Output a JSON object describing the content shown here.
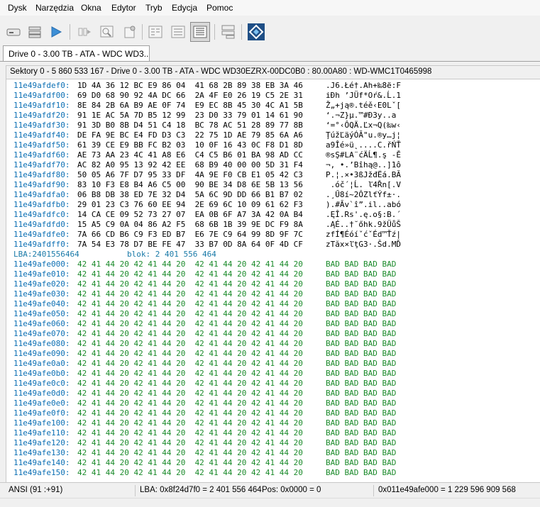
{
  "menu": [
    "Dysk",
    "Narzędzia",
    "Okna",
    "Edytor",
    "Tryb",
    "Edycja",
    "Pomoc"
  ],
  "toolbar": {
    "icons": [
      "drive-icon",
      "list-icon",
      "play-icon",
      "jump-icon",
      "search-icon",
      "settings-icon",
      "view-text-icon",
      "view-columns-icon",
      "view-hex-icon",
      "split-icon",
      "app-logo-icon"
    ]
  },
  "tab": {
    "label": "Drive 0 - 3.00 TB - ATA - WDC WD3..."
  },
  "info": {
    "text": "Sektory 0 - 5 860 533 167 - Drive 0 - 3.00 TB - ATA - WDC WD30EZRX-00DC0B0 : 80.00A80 : WD-WMC1T0465998"
  },
  "data_rows": [
    {
      "addr": "11e49afdef0:",
      "hex": "1D 4A 36 12 BC E9 86 04  41 68 2B 89 38 EB 3A 46",
      "ascii": ".J6.Łé†.Ah+‰8ë:F"
    },
    {
      "addr": "11e49afdf00:",
      "hex": "69 D0 68 90 92 4A DC 66  2A 4F E0 26 19 C5 2E 31",
      "ascii": "iĐh ’JÜf*Oŕ&.Ĺ.1"
    },
    {
      "addr": "11e49afdf10:",
      "hex": "8E 84 2B 6A B9 AE 0F 74  E9 EC 8B 45 30 4C A1 5B",
      "ascii": "Ž„+ją®.téě‹E0Lˇ["
    },
    {
      "addr": "11e49afdf20:",
      "hex": "91 1E AC 5A 7D B5 12 99  23 D0 33 79 01 14 61 90",
      "ascii": "‘.¬Z}µ.™#Đ3y..a "
    },
    {
      "addr": "11e49afdf30:",
      "hex": "91 3D B0 8B D4 51 C4 18  BC 78 AC 51 28 89 77 8B",
      "ascii": "‘=°‹ÔQÄ.Ľx¬Q(‰w‹"
    },
    {
      "addr": "11e49afdf40:",
      "hex": "DE FA 9E BC E4 FD D3 C3  22 75 1D AE 79 85 6A A6",
      "ascii": "ŢúžĽäýÓĂ\"u.®y…j¦"
    },
    {
      "addr": "11e49afdf50:",
      "hex": "61 39 CE E9 BB FC B2 03  10 0F 16 43 0C F8 D1 8D",
      "ascii": "a9Îé»ü˛....C.řŃŤ"
    },
    {
      "addr": "11e49afdf60:",
      "hex": "AE 73 AA 23 4C 41 A8 E6  C4 C5 B6 01 BA 98 AD CC",
      "ascii": "®sŞ#LA¨ćÄĹ¶.ş -Ě"
    },
    {
      "addr": "11e49afdf70:",
      "hex": "AC 82 A0 95 13 92 42 EE  68 B9 40 00 00 5D 31 F4",
      "ascii": "¬‚ •.’Bîhą@..]1ô"
    },
    {
      "addr": "11e49afdf80:",
      "hex": "50 05 A6 7F D7 95 33 DF  4A 9E F0 CB E1 05 42 C3",
      "ascii": "P.¦.×•3ßJžđËá.BĂ"
    },
    {
      "addr": "11e49afdf90:",
      "hex": "83 10 F3 E8 B4 A6 C5 00  90 BE 34 D8 6E 5B 13 56",
      "ascii": " .óč´¦Ĺ. ľ4Řn[.V"
    },
    {
      "addr": "11e49afdfa0:",
      "hex": "06 B8 DB 38 ED 7E 32 D4  5A 6C 9D DD 66 B1 B7 02",
      "ascii": ".¸Ű8í~2ÔZlťÝf±·."
    },
    {
      "addr": "11e49afdfb0:",
      "hex": "29 01 23 C3 76 60 EE 94  2E 69 6C 10 09 61 62 F3",
      "ascii": ").#Ăv`î”.il..abó"
    },
    {
      "addr": "11e49afdfc0:",
      "hex": "14 CA CE 09 52 73 27 07  EA 0B 6F A7 3A 42 0A B4",
      "ascii": ".ĘÎ.Rs'.ę.o§:B.´"
    },
    {
      "addr": "11e49afdfd0:",
      "hex": "15 A5 C9 0A 04 86 A2 F5  68 6B 1B 39 9E DC F9 8A",
      "ascii": ".ĄÉ..†˘őhk.9žÜůŠ"
    },
    {
      "addr": "11e49afdfe0:",
      "hex": "7A 66 CD B6 C9 F3 ED B7  E6 7E C9 64 99 8D 9F 7C",
      "ascii": "zfÍ¶ÉóíˇćˇÉd™Ťź|"
    },
    {
      "addr": "11e49afdff0:",
      "hex": "7A 54 E3 78 D7 BE FE 47  33 B7 0D 8A 64 0F 4D CF",
      "ascii": "zTăx×ľţG3·.Šd.MĎ"
    }
  ],
  "lba_marker": {
    "lba": "LBA:2401556464",
    "blok": "blok: 2 401 556 464"
  },
  "bad_hex": "42 41 44 20 42 41 44 20  42 41 44 20 42 41 44 20",
  "bad_ascii": "BAD BAD BAD BAD",
  "bad_addrs": [
    "11e49afe000:",
    "11e49afe010:",
    "11e49afe020:",
    "11e49afe030:",
    "11e49afe040:",
    "11e49afe050:",
    "11e49afe060:",
    "11e49afe070:",
    "11e49afe080:",
    "11e49afe090:",
    "11e49afe0a0:",
    "11e49afe0b0:",
    "11e49afe0c0:",
    "11e49afe0d0:",
    "11e49afe0e0:",
    "11e49afe0f0:",
    "11e49afe100:",
    "11e49afe110:",
    "11e49afe120:",
    "11e49afe130:",
    "11e49afe140:",
    "11e49afe150:"
  ],
  "status": {
    "encoding": "ANSI (91 :+91)",
    "lba": "LBA: 0x8f24d7f0 = 2 401 556 464",
    "pos": "Pos: 0x0000 = 0",
    "offset": "0x011e49afe000 = 1 229 596 909 568"
  }
}
